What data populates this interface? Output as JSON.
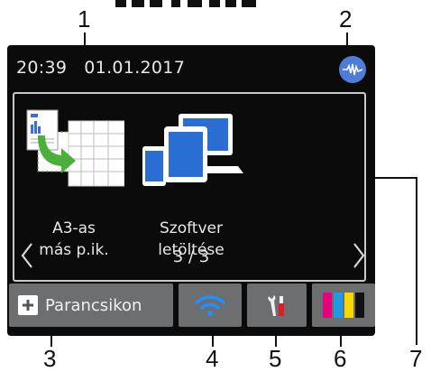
{
  "status_bar": {
    "time": "20:39",
    "date": "01.01.2017",
    "wireless_icon": "wireless-signal-icon",
    "wireless_color": "#4d7dd8"
  },
  "apps": [
    {
      "icon": "a3-copy-icon",
      "line1": "A3-as",
      "line2": "más p.ik."
    },
    {
      "icon": "software-download-icon",
      "line1": "Szoftver",
      "line2": "letöltése"
    }
  ],
  "pager": {
    "label": "3 / 3"
  },
  "bottom_bar": {
    "shortcuts_label": "Parancsikon",
    "wifi_icon": "wifi-icon",
    "settings_icon": "settings-tools-icon",
    "ink_icon": "ink-cartridges-icon",
    "ink_colors": [
      "#e6007e",
      "#1e9be5",
      "#f5d800",
      "#111111"
    ]
  },
  "callouts": [
    "1",
    "2",
    "3",
    "4",
    "5",
    "6",
    "7"
  ]
}
